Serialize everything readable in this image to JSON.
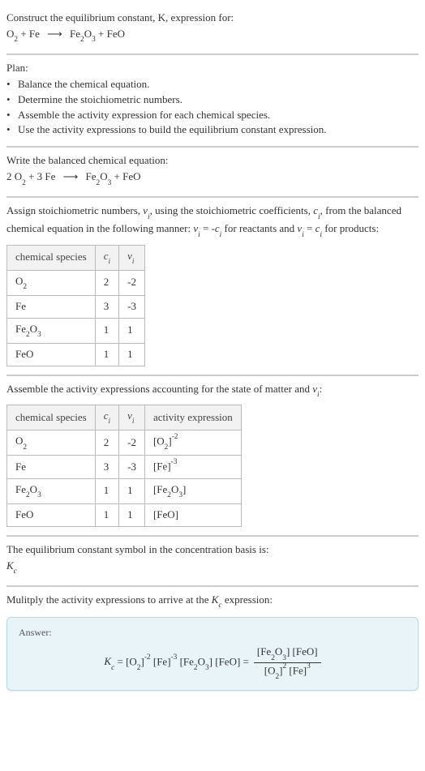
{
  "s1": {
    "prompt": "Construct the equilibrium constant, K, expression for:",
    "eq": "O₂ + Fe ⟶ Fe₂O₃ + FeO"
  },
  "s2": {
    "title": "Plan:",
    "b1": "Balance the chemical equation.",
    "b2": "Determine the stoichiometric numbers.",
    "b3": "Assemble the activity expression for each chemical species.",
    "b4": "Use the activity expressions to build the equilibrium constant expression."
  },
  "s3": {
    "title": "Write the balanced chemical equation:",
    "eq": "2 O₂ + 3 Fe ⟶ Fe₂O₃ + FeO"
  },
  "s4": {
    "intro1": "Assign stoichiometric numbers, νᵢ, using the stoichiometric coefficients, cᵢ, from the balanced chemical equation in the following manner: νᵢ = -cᵢ for reactants and νᵢ = cᵢ for products:",
    "h1": "chemical species",
    "h2": "cᵢ",
    "h3": "νᵢ",
    "r1c1": "O₂",
    "r1c2": "2",
    "r1c3": "-2",
    "r2c1": "Fe",
    "r2c2": "3",
    "r2c3": "-3",
    "r3c1": "Fe₂O₃",
    "r3c2": "1",
    "r3c3": "1",
    "r4c1": "FeO",
    "r4c2": "1",
    "r4c3": "1"
  },
  "s5": {
    "intro": "Assemble the activity expressions accounting for the state of matter and νᵢ:",
    "h1": "chemical species",
    "h2": "cᵢ",
    "h3": "νᵢ",
    "h4": "activity expression",
    "r1c1": "O₂",
    "r1c2": "2",
    "r1c3": "-2",
    "r1c4": "[O₂]⁻²",
    "r2c1": "Fe",
    "r2c2": "3",
    "r2c3": "-3",
    "r2c4": "[Fe]⁻³",
    "r3c1": "Fe₂O₃",
    "r3c2": "1",
    "r3c3": "1",
    "r3c4": "[Fe₂O₃]",
    "r4c1": "FeO",
    "r4c2": "1",
    "r4c3": "1",
    "r4c4": "[FeO]"
  },
  "s6": {
    "line1": "The equilibrium constant symbol in the concentration basis is:",
    "sym": "K𝒸"
  },
  "s7": {
    "line": "Mulitply the activity expressions to arrive at the K𝒸 expression:"
  },
  "answer": {
    "label": "Answer:",
    "lhs": "K𝒸 = [O₂]⁻² [Fe]⁻³ [Fe₂O₃] [FeO] =",
    "num": "[Fe₂O₃] [FeO]",
    "den": "[O₂]² [Fe]³"
  }
}
